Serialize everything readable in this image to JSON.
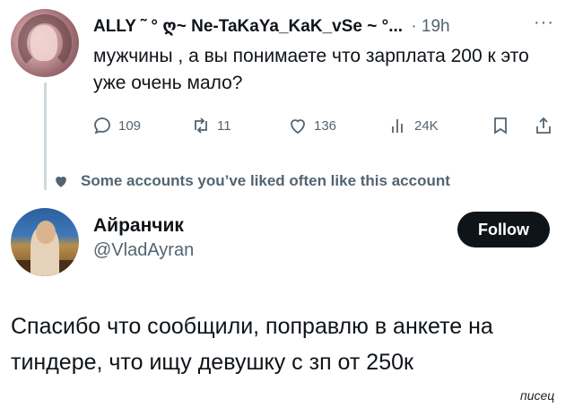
{
  "tweet1": {
    "author_display": "ALLY ˜ ° ღ~ Ne-TaKaYa_KaK_vSe ~ °...",
    "timestamp": "· 19h",
    "more": "···",
    "text": "мужчины , а вы понимаете что зарплата 200 к это уже очень мало?",
    "actions": {
      "replies": "109",
      "retweets": "11",
      "likes": "136",
      "views": "24K"
    }
  },
  "liked_notice": "Some accounts you’ve liked often like this account",
  "tweet2": {
    "author_name": "Айранчик",
    "handle": "@VladAyran",
    "follow_label": "Follow",
    "text": "Спасибо что сообщили, поправлю в анкете на тиндере, что ищу девушку с зп от 250к"
  },
  "watermark": "писец",
  "colors": {
    "text_primary": "#0f1419",
    "text_secondary": "#536471",
    "follow_bg": "#0f1419",
    "thread_line": "#cfd9de"
  }
}
